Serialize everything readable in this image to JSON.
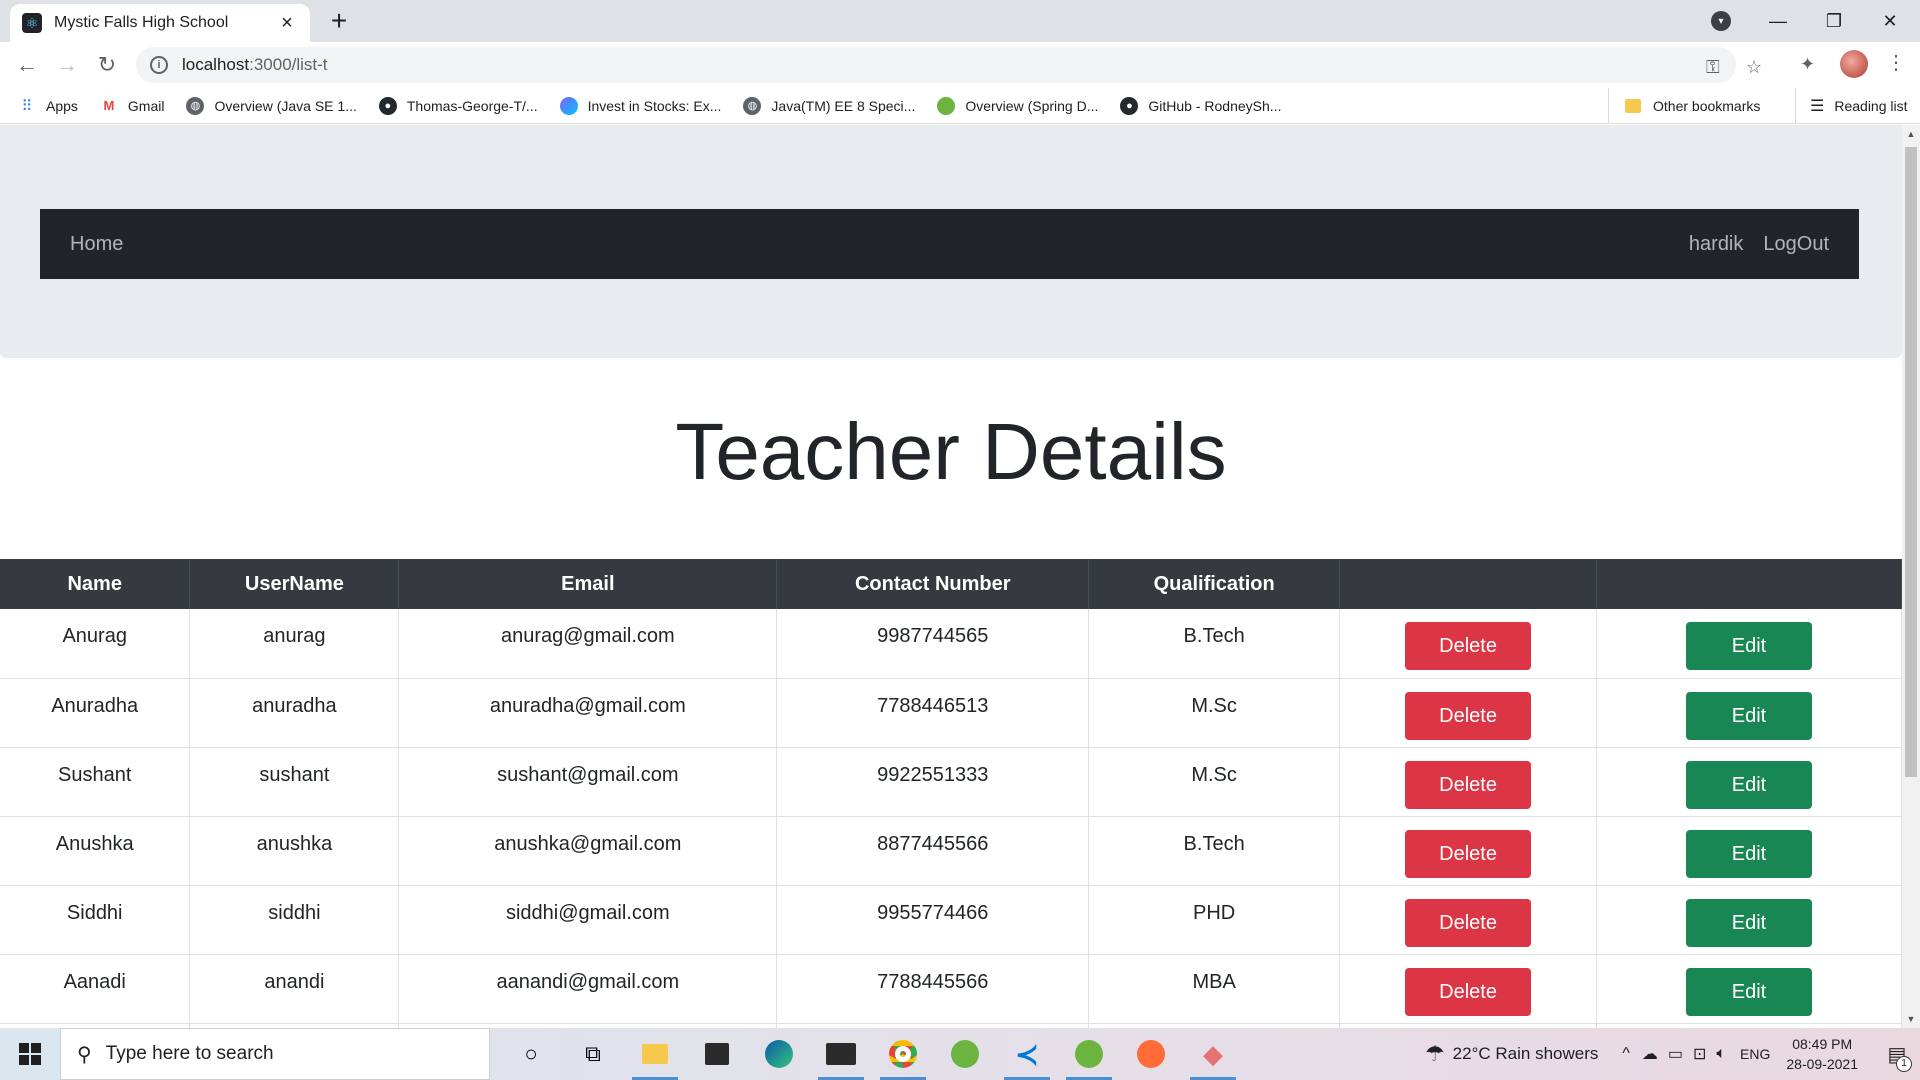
{
  "browser": {
    "tab_title": "Mystic Falls High School",
    "url_host": "localhost",
    "url_rest": ":3000/list-t",
    "bookmarks": [
      {
        "label": "Apps",
        "icon": "apps-grid-icon"
      },
      {
        "label": "Gmail",
        "icon": "gmail-icon"
      },
      {
        "label": "Overview (Java SE 1...",
        "icon": "globe-icon"
      },
      {
        "label": "Thomas-George-T/...",
        "icon": "github-icon"
      },
      {
        "label": "Invest in Stocks: Ex...",
        "icon": "invest-icon"
      },
      {
        "label": "Java(TM) EE 8 Speci...",
        "icon": "globe-icon"
      },
      {
        "label": "Overview (Spring D...",
        "icon": "spring-icon"
      },
      {
        "label": "GitHub - RodneySh...",
        "icon": "github-icon"
      }
    ],
    "other_bookmarks": "Other bookmarks",
    "reading_list": "Reading list"
  },
  "navbar": {
    "home": "Home",
    "user": "hardik",
    "logout": "LogOut"
  },
  "page": {
    "title": "Teacher Details"
  },
  "table": {
    "headers": [
      "Name",
      "UserName",
      "Email",
      "Contact Number",
      "Qualification"
    ],
    "delete_label": "Delete",
    "edit_label": "Edit",
    "rows": [
      {
        "name": "Anurag",
        "username": "anurag",
        "email": "anurag@gmail.com",
        "contact": "9987744565",
        "qualification": "B.Tech"
      },
      {
        "name": "Anuradha",
        "username": "anuradha",
        "email": "anuradha@gmail.com",
        "contact": "7788446513",
        "qualification": "M.Sc"
      },
      {
        "name": "Sushant",
        "username": "sushant",
        "email": "sushant@gmail.com",
        "contact": "9922551333",
        "qualification": "M.Sc"
      },
      {
        "name": "Anushka",
        "username": "anushka",
        "email": "anushka@gmail.com",
        "contact": "8877445566",
        "qualification": "B.Tech"
      },
      {
        "name": "Siddhi",
        "username": "siddhi",
        "email": "siddhi@gmail.com",
        "contact": "9955774466",
        "qualification": "PHD"
      },
      {
        "name": "Aanadi",
        "username": "anandi",
        "email": "aanandi@gmail.com",
        "contact": "7788445566",
        "qualification": "MBA"
      }
    ]
  },
  "taskbar": {
    "search_placeholder": "Type here to search",
    "weather": "22°C  Rain showers",
    "language": "ENG",
    "time": "08:49 PM",
    "date": "28-09-2021",
    "notification_count": "1"
  },
  "colors": {
    "navbar_bg": "#212529",
    "table_header_bg": "#343a40",
    "delete_button": "#dc3545",
    "edit_button": "#198754",
    "jumbotron_bg": "#e9ecef"
  }
}
